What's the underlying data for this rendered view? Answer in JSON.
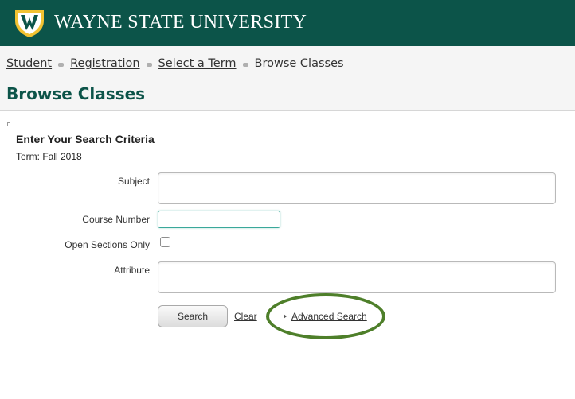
{
  "header": {
    "brand_name": "WAYNE STATE UNIVERSITY",
    "logo_icon": "wsu-shield-logo-icon",
    "bar_color": "#0c5449",
    "logo_gold": "#f2c232"
  },
  "breadcrumb": {
    "items": [
      {
        "label": "Student",
        "link": true
      },
      {
        "label": "Registration",
        "link": true
      },
      {
        "label": "Select a Term",
        "link": true
      },
      {
        "label": "Browse Classes",
        "link": false
      }
    ]
  },
  "page": {
    "title": "Browse Classes",
    "title_color": "#0c5449"
  },
  "form": {
    "heading": "Enter Your Search Criteria",
    "term_text": "Term: Fall 2018",
    "fields": {
      "subject": {
        "label": "Subject",
        "value": ""
      },
      "course_number": {
        "label": "Course Number",
        "value": ""
      },
      "open_sections": {
        "label": "Open Sections Only",
        "checked": false
      },
      "attribute": {
        "label": "Attribute",
        "value": ""
      }
    },
    "actions": {
      "search_label": "Search",
      "clear_label": "Clear",
      "advanced_label": "Advanced Search",
      "highlight_color": "#4e7f2a"
    }
  }
}
